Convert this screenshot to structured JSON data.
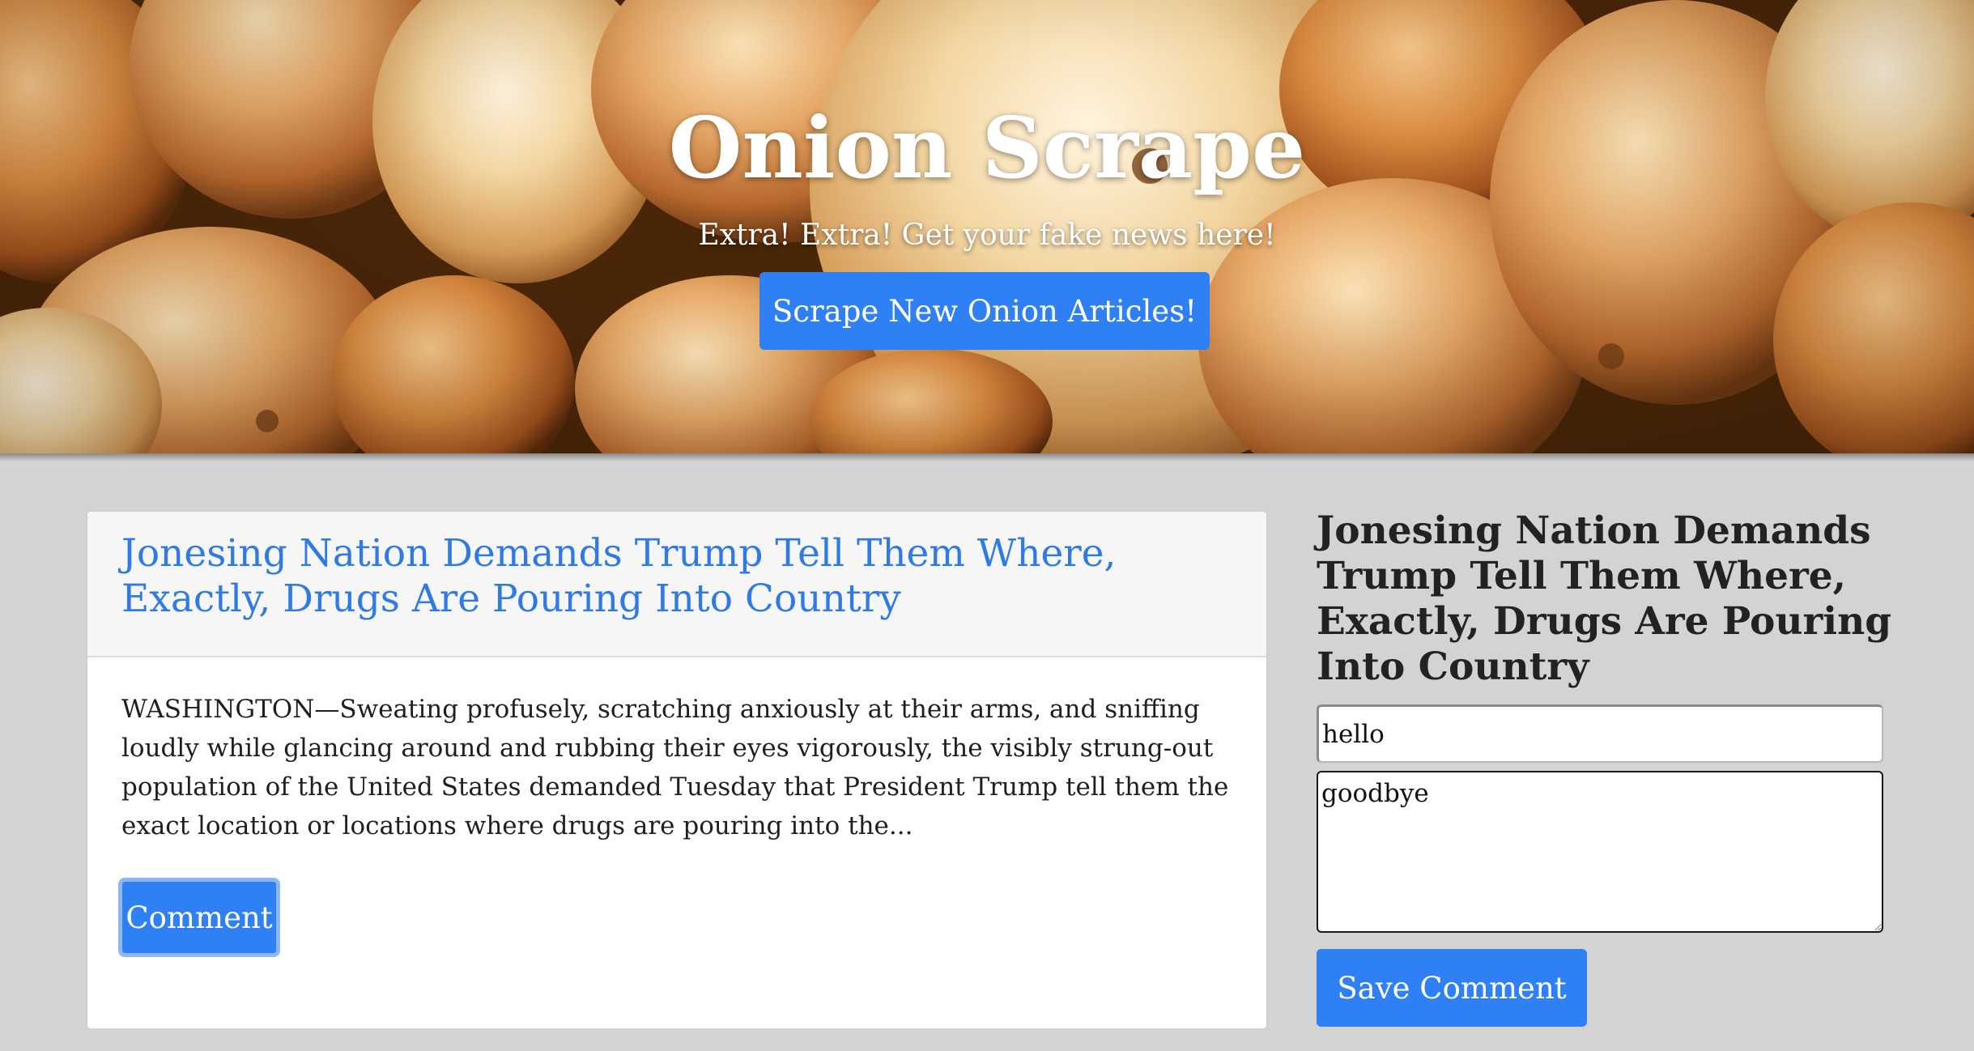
{
  "header": {
    "title": "Onion Scrape",
    "tagline": "Extra! Extra! Get your fake news here!",
    "scrape_button_label": "Scrape New Onion Articles!",
    "hero_image": "onions-photo"
  },
  "article": {
    "title": "Jonesing Nation Demands Trump Tell Them Where, Exactly, Drugs Are Pouring Into Country",
    "summary": "WASHINGTON—Sweating profusely, scratching anxiously at their arms, and sniffing loudly while glancing around and rubbing their eyes vigorously, the visibly strung-out population of the United States demanded Tuesday that President Trump tell them the exact location or locations where drugs are pouring into the...",
    "comment_button_label": "Comment"
  },
  "comment_panel": {
    "article_title": "Jonesing Nation Demands Trump Tell Them Where, Exactly, Drugs Are Pouring Into Country",
    "title_input_value": "hello",
    "body_input_value": "goodbye",
    "save_button_label": "Save Comment"
  },
  "colors": {
    "accent": "#2f80f5",
    "link": "#2f7ae5",
    "page_background": "#d3d3d3"
  }
}
